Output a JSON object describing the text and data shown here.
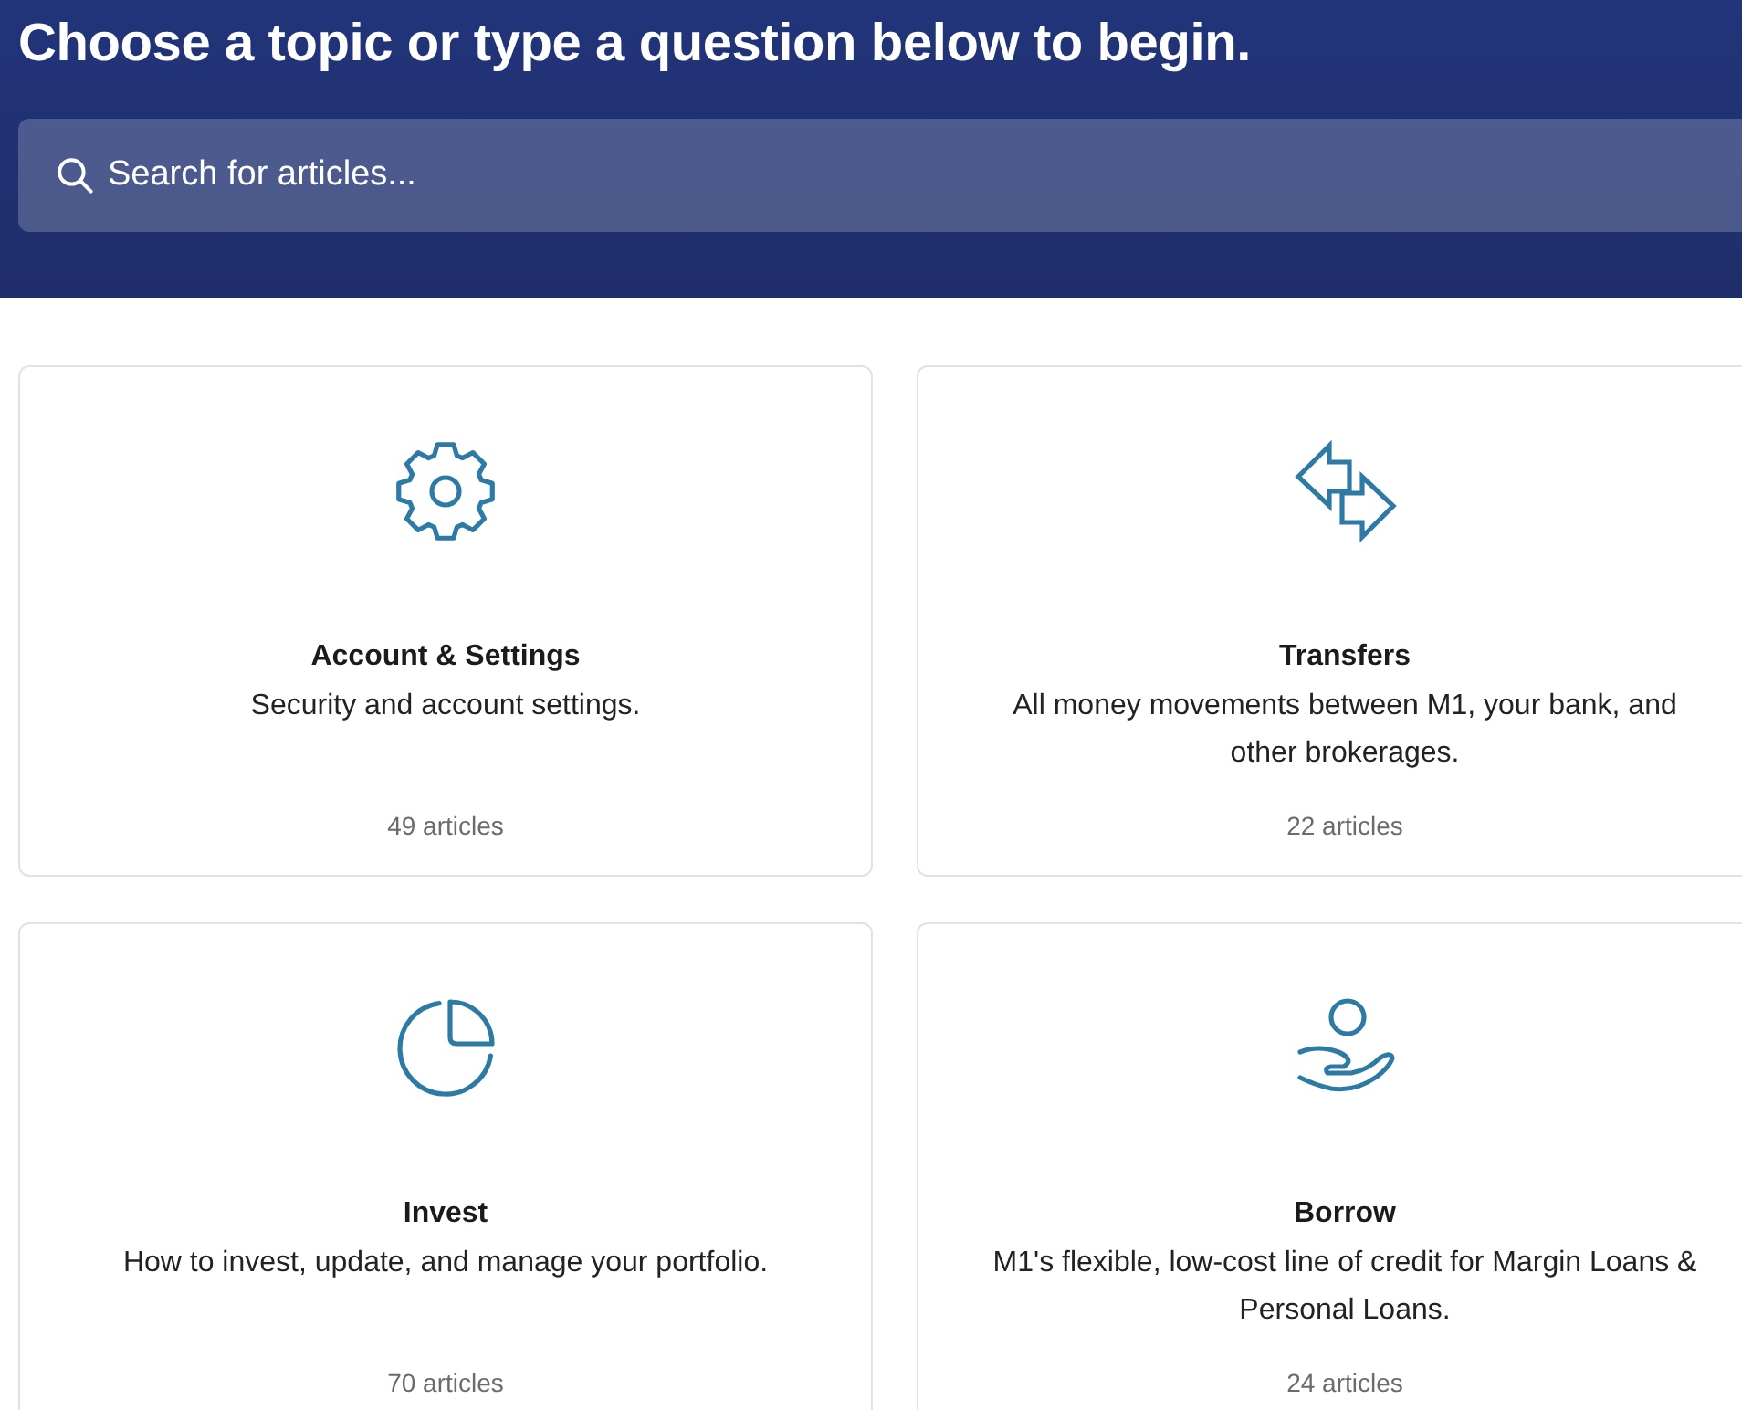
{
  "header": {
    "title": "Choose a topic or type a question below to begin.",
    "search": {
      "placeholder": "Search for articles..."
    }
  },
  "topics": [
    {
      "kind": "gear",
      "title": "Account & Settings",
      "description": "Security and account settings.",
      "count": "49 articles"
    },
    {
      "kind": "transfer",
      "title": "Transfers",
      "description": "All money movements between M1, your bank, and other brokerages.",
      "count": "22 articles"
    },
    {
      "kind": "pie",
      "title": "Invest",
      "description": "How to invest, update, and manage your portfolio.",
      "count": "70 articles"
    },
    {
      "kind": "coin",
      "title": "Borrow",
      "description": "M1's flexible, low-cost line of credit for Margin Loans & Personal Loans.",
      "count": "24 articles"
    }
  ]
}
